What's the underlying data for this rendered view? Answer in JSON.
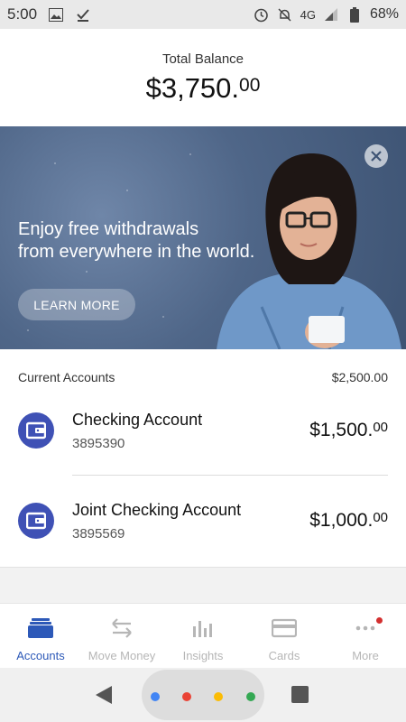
{
  "status_bar": {
    "time": "5:00",
    "network": "4G",
    "battery": "68%",
    "icons": [
      "image-icon",
      "check-icon",
      "alarm-icon",
      "bell-off-icon",
      "signal-icon",
      "battery-icon"
    ]
  },
  "summary": {
    "label": "Total Balance",
    "amount_main": "$3,750.",
    "amount_cents": "00"
  },
  "banner": {
    "line1": "Enjoy free withdrawals",
    "line2": "from everywhere in the world.",
    "cta": "LEARN MORE",
    "close_icon": "close-icon"
  },
  "accounts": {
    "header_label": "Current Accounts",
    "header_total": "$2,500.00",
    "items": [
      {
        "name": "Checking Account",
        "number": "3895390",
        "amount_main": "$1,500.",
        "amount_cents": "00",
        "icon": "wallet-icon"
      },
      {
        "name": "Joint Checking Account",
        "number": "3895569",
        "amount_main": "$1,000.",
        "amount_cents": "00",
        "icon": "wallet-icon"
      }
    ]
  },
  "bottom_nav": {
    "items": [
      {
        "label": "Accounts",
        "icon": "accounts-icon",
        "active": true
      },
      {
        "label": "Move Money",
        "icon": "transfer-icon",
        "active": false
      },
      {
        "label": "Insights",
        "icon": "bar-chart-icon",
        "active": false
      },
      {
        "label": "Cards",
        "icon": "card-icon",
        "active": false
      },
      {
        "label": "More",
        "icon": "more-icon",
        "active": false
      }
    ]
  },
  "colors": {
    "accent": "#2d59b8",
    "account_icon_bg": "#3f51b5",
    "inactive_nav": "#b6b6b6",
    "notification_dot": "#d32f2f"
  }
}
